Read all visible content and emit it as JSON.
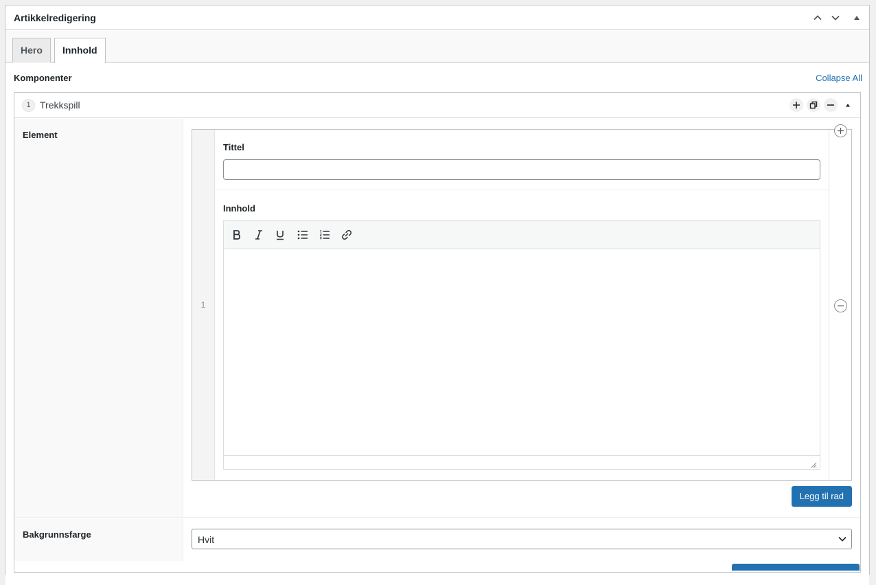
{
  "postbox": {
    "title": "Artikkelredigering",
    "controls": [
      "chevron-up-icon",
      "chevron-down-icon",
      "triangle-up-icon"
    ]
  },
  "tabs": [
    {
      "label": "Hero",
      "active": false
    },
    {
      "label": "Innhold",
      "active": true
    }
  ],
  "components": {
    "label": "Komponenter",
    "collapse_all": "Collapse All"
  },
  "layout": {
    "order": "1",
    "name": "Trekkspill",
    "controls": [
      "plus-icon",
      "duplicate-icon",
      "minus-icon",
      "triangle-up-icon"
    ]
  },
  "element_field": {
    "label": "Element",
    "rows": [
      {
        "number": "1",
        "title_label": "Tittel",
        "title_value": "",
        "content_label": "Innhold",
        "toolbar": [
          "bold-icon",
          "italic-icon",
          "underline-icon",
          "bullet-list-icon",
          "numbered-list-icon",
          "link-icon"
        ]
      }
    ],
    "add_row_label": "Legg til rad"
  },
  "background_field": {
    "label": "Bakgrunnsfarge",
    "selected": "Hvit"
  },
  "colors": {
    "accent": "#2271b1",
    "border": "#c3c4c7",
    "text": "#1d2327"
  }
}
